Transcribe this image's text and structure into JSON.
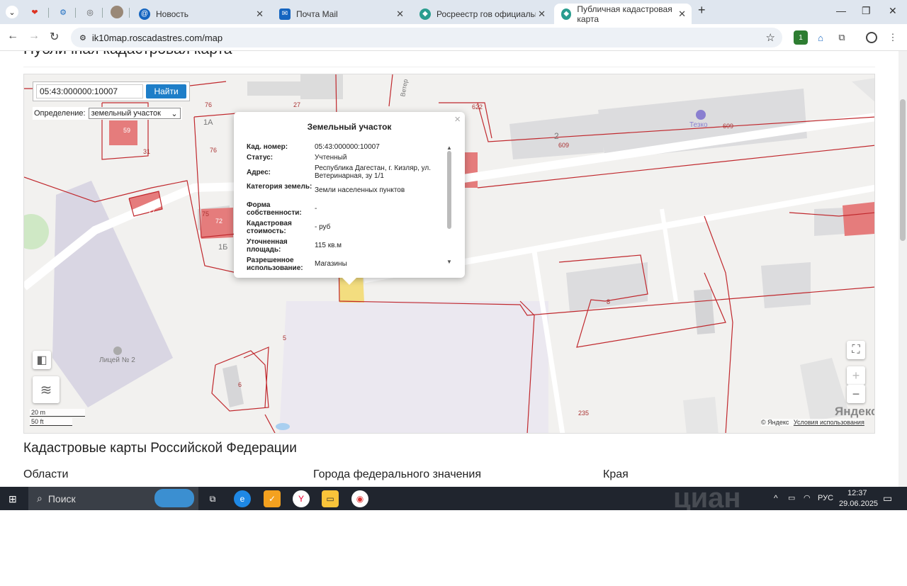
{
  "browser": {
    "tabs": [
      {
        "title": "Новость"
      },
      {
        "title": "Почта Mail"
      },
      {
        "title": "Росреестр гов официальный с"
      },
      {
        "title": "Публичная кадастровая карта"
      }
    ],
    "url": "ik10map.roscadastres.com/map",
    "extension_badge": "1"
  },
  "page": {
    "title": "Публичная кадастровая карта",
    "section_title": "Кадастровые карты Российской Федерации",
    "columns": [
      "Области",
      "Города федерального значения",
      "Края"
    ]
  },
  "map": {
    "search_value": "05:43:000000:10007",
    "search_button": "Найти",
    "definition_label": "Определение:",
    "definition_value": "земельный участок",
    "scale_m": "20 m",
    "scale_ft": "50 ft",
    "copyright": "© Яндекс",
    "terms": "Условия использования",
    "brand": "Яндекс",
    "labels": [
      "76",
      "27",
      "622",
      "59",
      "1А",
      "31",
      "76",
      "2",
      "609",
      "Тезко",
      "609",
      "17",
      "75",
      "72",
      "1Б",
      "8",
      "5",
      "Лицей № 2",
      "6",
      "235",
      "Ветер"
    ]
  },
  "popup": {
    "title": "Земельный участок",
    "rows": [
      {
        "k": "Кад. номер:",
        "v": "05:43:000000:10007"
      },
      {
        "k": "Статус:",
        "v": "Учтенный"
      },
      {
        "k": "Адрес:",
        "v": "Республика Дагестан, г. Кизляр, ул. Ветеринарная, зу 1/1"
      },
      {
        "k": "Категория земель:",
        "v": "Земли населенных пунктов"
      },
      {
        "k": "Форма собственности:",
        "v": "-"
      },
      {
        "k": "Кадастровая стоимость:",
        "v": "- руб"
      },
      {
        "k": "Уточненная площадь:",
        "v": "115 кв.м"
      },
      {
        "k": "Разрешенное использование:",
        "v": "Магазины"
      }
    ]
  },
  "taskbar": {
    "search": "Поиск",
    "lang": "РУС",
    "time": "12:37",
    "date": "29.06.2025",
    "watermark": "циан"
  }
}
